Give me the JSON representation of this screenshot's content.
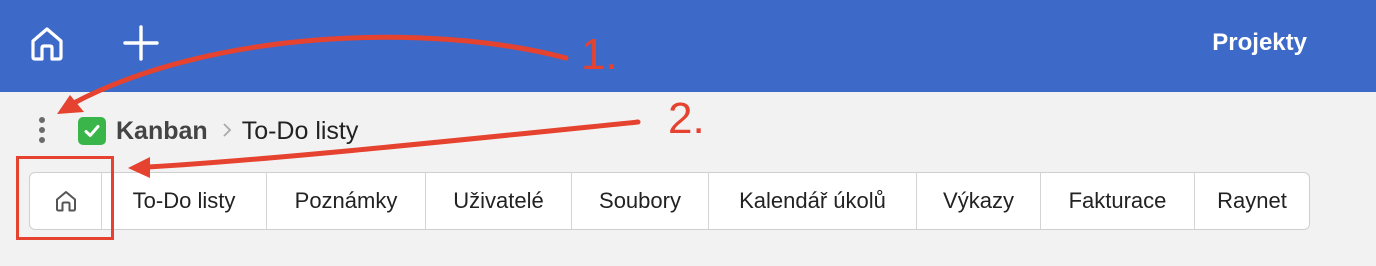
{
  "topbar": {
    "home_icon": "home-icon",
    "add_icon": "plus-icon",
    "projects_label": "Projekty",
    "background_color": "#3d6ac8"
  },
  "breadcrumb": {
    "menu_icon": "kebab-menu-icon",
    "status_icon": "check-mark-icon",
    "project": "Kanban",
    "separator_icon": "chevron-right-icon",
    "current": "To-Do listy"
  },
  "tabs": {
    "home_icon": "home-icon",
    "items": [
      "To-Do listy",
      "Poznámky",
      "Uživatelé",
      "Soubory",
      "Kalendář úkolů",
      "Výkazy",
      "Fakturace",
      "Raynet"
    ]
  },
  "annotations": {
    "label_1": "1.",
    "label_2": "2.",
    "color": "#e5422f"
  }
}
